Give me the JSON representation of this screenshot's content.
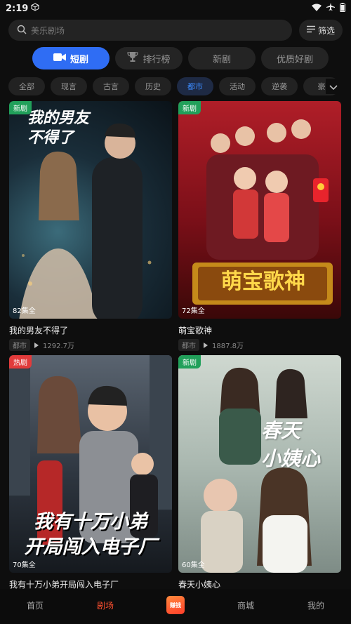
{
  "status_bar": {
    "time": "2:19"
  },
  "search": {
    "placeholder": "美乐剧场",
    "filter_label": "筛选"
  },
  "main_tabs": [
    {
      "label": "短剧",
      "active": true
    },
    {
      "label": "排行榜",
      "active": false
    },
    {
      "label": "新剧",
      "active": false
    },
    {
      "label": "优质好剧",
      "active": false
    }
  ],
  "categories": [
    "全部",
    "现言",
    "古言",
    "历史",
    "都市",
    "活动",
    "逆袭",
    "豪"
  ],
  "active_category": "都市",
  "dramas": [
    {
      "title": "我的男友不得了",
      "poster_title": "我的男友 不得了",
      "badge": "新剧",
      "episodes": "82集全",
      "genre": "都市",
      "plays": "1292.7万"
    },
    {
      "title": "萌宝歌神",
      "poster_title": "萌宝歌神",
      "badge": "新剧",
      "episodes": "72集全",
      "genre": "都市",
      "plays": "1887.8万"
    },
    {
      "title": "我有十万小弟开局闯入电子厂",
      "poster_title": "我有十万小弟 开局闯入电子厂",
      "badge": "热剧",
      "episodes": "70集全",
      "genre": "",
      "plays": ""
    },
    {
      "title": "春天小姨心",
      "poster_title": "春天 小姨心",
      "badge": "新剧",
      "episodes": "60集全",
      "genre": "",
      "plays": ""
    }
  ],
  "bottom_nav": [
    {
      "label": "首页",
      "active": false
    },
    {
      "label": "剧场",
      "active": true
    },
    {
      "label": "赚钱",
      "active": false
    },
    {
      "label": "商城",
      "active": false
    },
    {
      "label": "我的",
      "active": false
    }
  ],
  "colors": {
    "accent": "#2f6df4",
    "nav_active": "#ff5030",
    "badge_new": "#21a05a",
    "badge_hot": "#e23b3b"
  }
}
